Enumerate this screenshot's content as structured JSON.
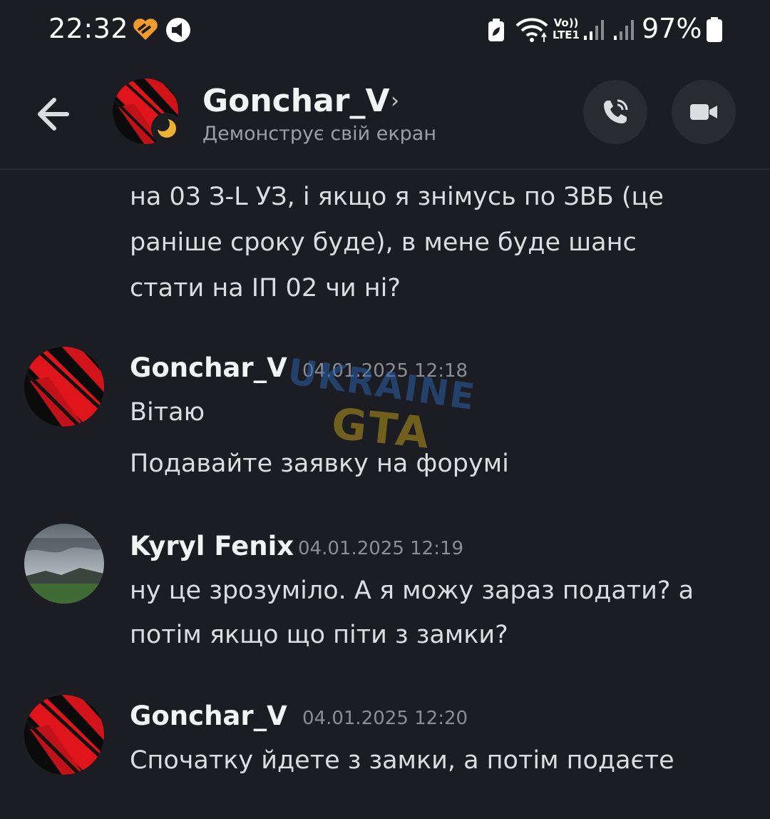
{
  "status_bar": {
    "time": "22:32",
    "battery_percent": "97%",
    "network_label": "LTE1",
    "volte_label": "Vo))",
    "icons": [
      "heart-app-icon",
      "notification-app-icon",
      "battery-saver-icon",
      "wifi-icon",
      "volte-icon",
      "signal-sim1-icon",
      "signal-sim2-icon",
      "battery-icon"
    ]
  },
  "header": {
    "title": "Gonchar_V",
    "chevron": "›",
    "subtitle": "Демонструє свій екран",
    "status": "idle-moon",
    "call_icon": "phone-call-icon",
    "video_icon": "video-camera-icon"
  },
  "messages": [
    {
      "continued": true,
      "lines": [
        "на 03 З-L УЗ, і якщо я знімусь по ЗВБ (це",
        "раніше сроку буде), в мене буде шанс",
        "стати на ІП 02 чи ні?"
      ]
    },
    {
      "author": "Gonchar_V",
      "timestamp": "04.01.2025 12:18",
      "avatar": "red-black-avatar",
      "lines": [
        "Вітаю",
        "Подавайте заявку на форумі"
      ]
    },
    {
      "author": "Kyryl Fenix",
      "timestamp": "04.01.2025 12:19",
      "avatar": "landscape-avatar",
      "lines": [
        "ну це зрозуміло. А я можу зараз подати? а",
        "потім якщо що піти з замки?"
      ]
    },
    {
      "author": "Gonchar_V",
      "timestamp": "04.01.2025 12:20",
      "avatar": "red-black-avatar",
      "lines": [
        "Спочатку йдете з замки, а потім подаєте"
      ]
    }
  ],
  "watermark": {
    "line1": "UKRAINE",
    "line2": "GTA"
  },
  "colors": {
    "background": "#1c1d22",
    "text": "#dcdde1",
    "timestamp": "#8a8d94",
    "idle_status": "#f0b232",
    "avatar_red": "#e0151b"
  }
}
